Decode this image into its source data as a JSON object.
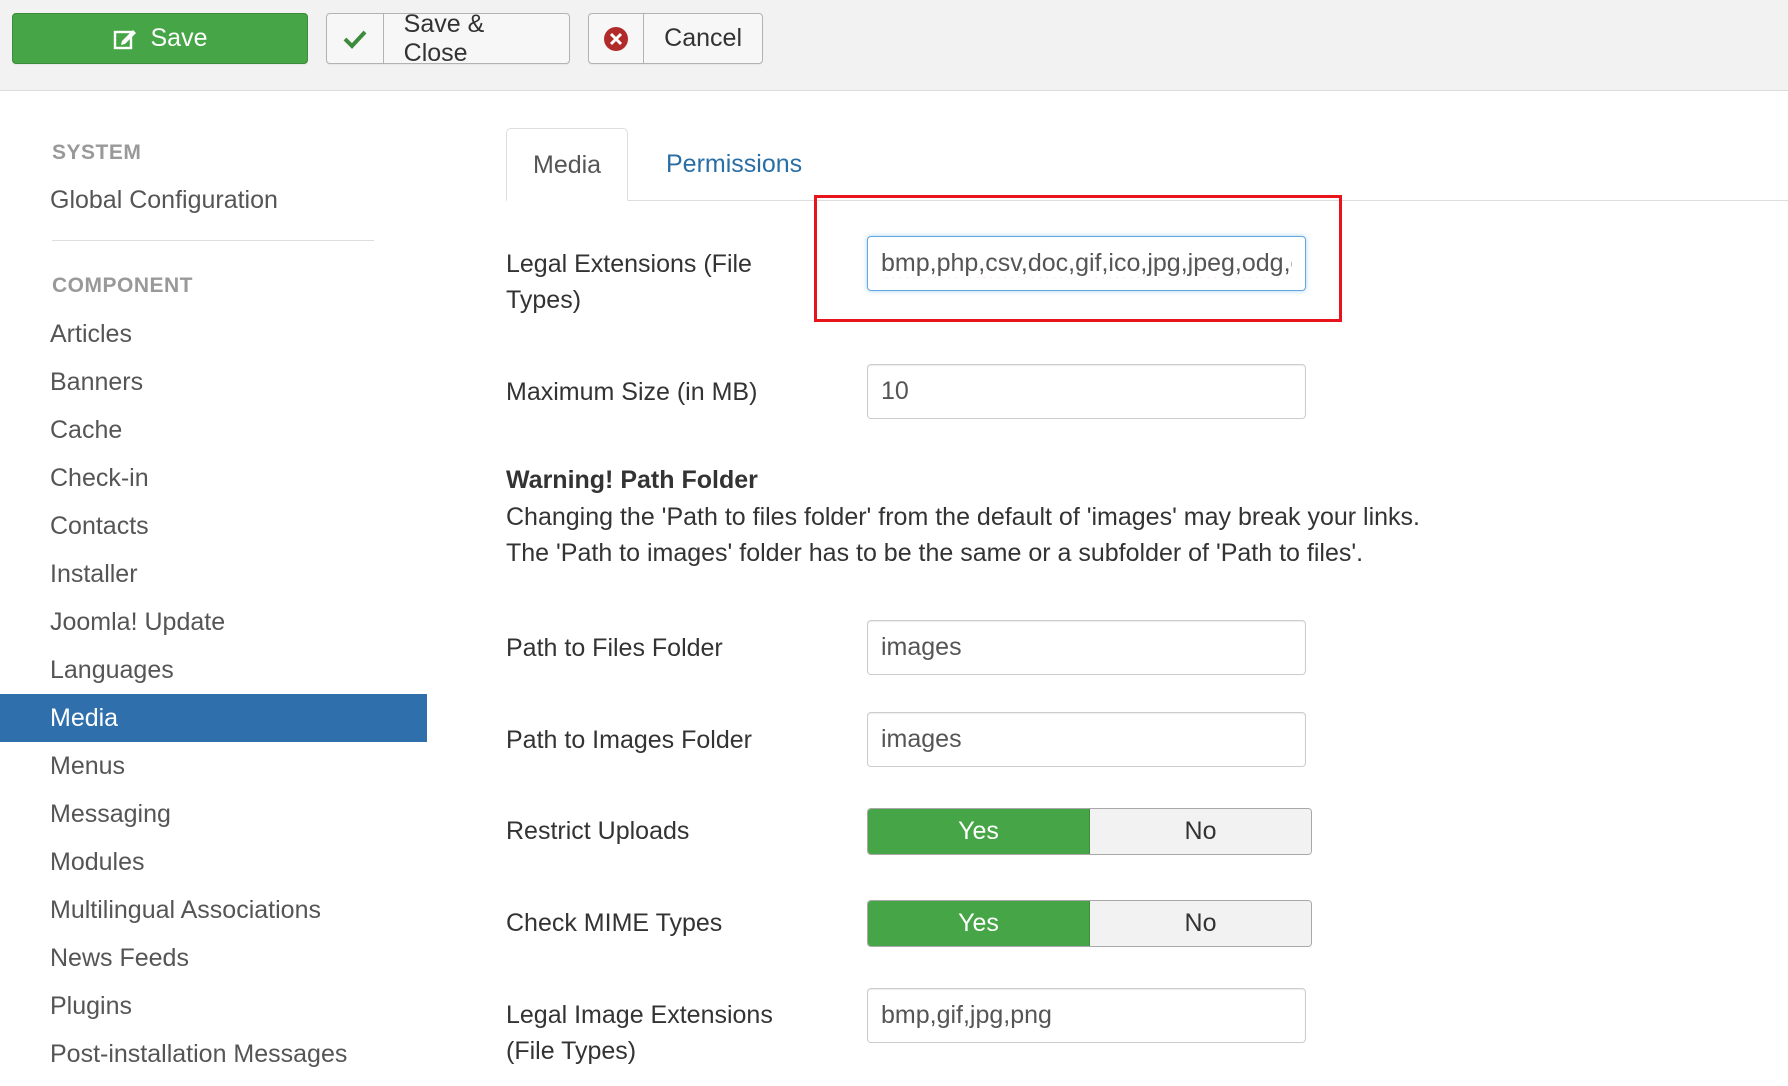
{
  "toolbar": {
    "save_label": "Save",
    "save_close_label": "Save & Close",
    "cancel_label": "Cancel"
  },
  "sidebar": {
    "system_header": "SYSTEM",
    "system_items": [
      {
        "label": "Global Configuration"
      }
    ],
    "component_header": "COMPONENT",
    "component_items": [
      {
        "label": "Articles"
      },
      {
        "label": "Banners"
      },
      {
        "label": "Cache"
      },
      {
        "label": "Check-in"
      },
      {
        "label": "Contacts"
      },
      {
        "label": "Installer"
      },
      {
        "label": "Joomla! Update"
      },
      {
        "label": "Languages"
      },
      {
        "label": "Media",
        "active": true
      },
      {
        "label": "Menus"
      },
      {
        "label": "Messaging"
      },
      {
        "label": "Modules"
      },
      {
        "label": "Multilingual Associations"
      },
      {
        "label": "News Feeds"
      },
      {
        "label": "Plugins"
      },
      {
        "label": "Post-installation Messages"
      }
    ]
  },
  "tabs": [
    {
      "label": "Media",
      "active": true
    },
    {
      "label": "Permissions",
      "active": false
    }
  ],
  "form": {
    "legal_extensions": {
      "label_line1": "Legal Extensions (File",
      "label_line2": "Types)",
      "value": "bmp,php,csv,doc,gif,ico,jpg,jpeg,odg,odp,ods,odt,pdf,png,ppt,txt,xcf,xls"
    },
    "max_size": {
      "label": "Maximum Size (in MB)",
      "value": "10"
    },
    "warning": {
      "title": "Warning! Path Folder",
      "line1": "Changing the 'Path to files folder' from the default of 'images' may break your links.",
      "line2": "The 'Path to images' folder has to be the same or a subfolder of 'Path to files'."
    },
    "files_path": {
      "label": "Path to Files Folder",
      "value": "images"
    },
    "images_path": {
      "label": "Path to Images Folder",
      "value": "images"
    },
    "restrict_uploads": {
      "label": "Restrict Uploads",
      "yes": "Yes",
      "no": "No",
      "selected": "Yes"
    },
    "check_mime": {
      "label": "Check MIME Types",
      "yes": "Yes",
      "no": "No",
      "selected": "Yes"
    },
    "legal_image_extensions": {
      "label_line1": "Legal Image Extensions",
      "label_line2": "(File Types)",
      "value": "bmp,gif,jpg,png"
    }
  },
  "colors": {
    "save_green": "#46a546",
    "active_nav_blue": "#2f6fab",
    "link_blue": "#2a6ea6",
    "annotation_red": "#e8141c"
  }
}
